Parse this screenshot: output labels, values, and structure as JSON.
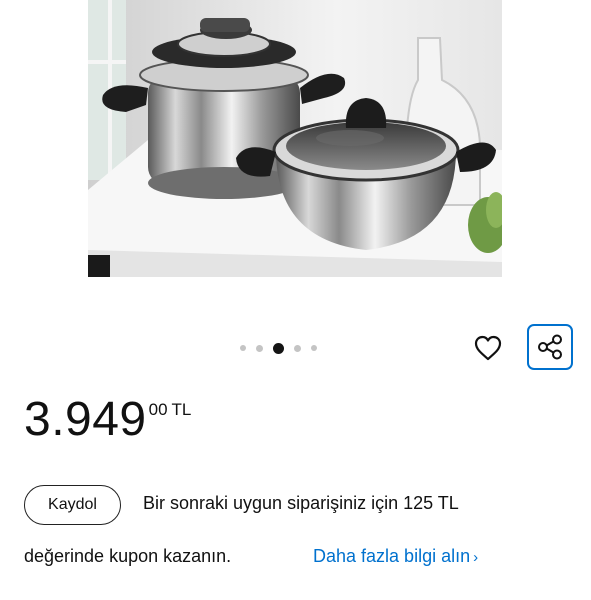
{
  "product_image": {
    "alt": ""
  },
  "carousel": {
    "count": 5,
    "active_index": 2
  },
  "price": {
    "main": "3.949",
    "fraction": "00",
    "currency": "TL"
  },
  "promo": {
    "button_label": "Kaydol",
    "line1": "Bir sonraki uygun siparişiniz için 125 TL",
    "line2": "değerinde kupon kazanın.",
    "link_label": "Daha fazla bilgi alın",
    "link_chevron": "›"
  },
  "colors": {
    "accent": "#0071ce",
    "dot_inactive": "#c4c4c4",
    "dot_active": "#141414"
  },
  "icons": {
    "favorite": "heart-outline-icon",
    "share": "share-icon"
  }
}
